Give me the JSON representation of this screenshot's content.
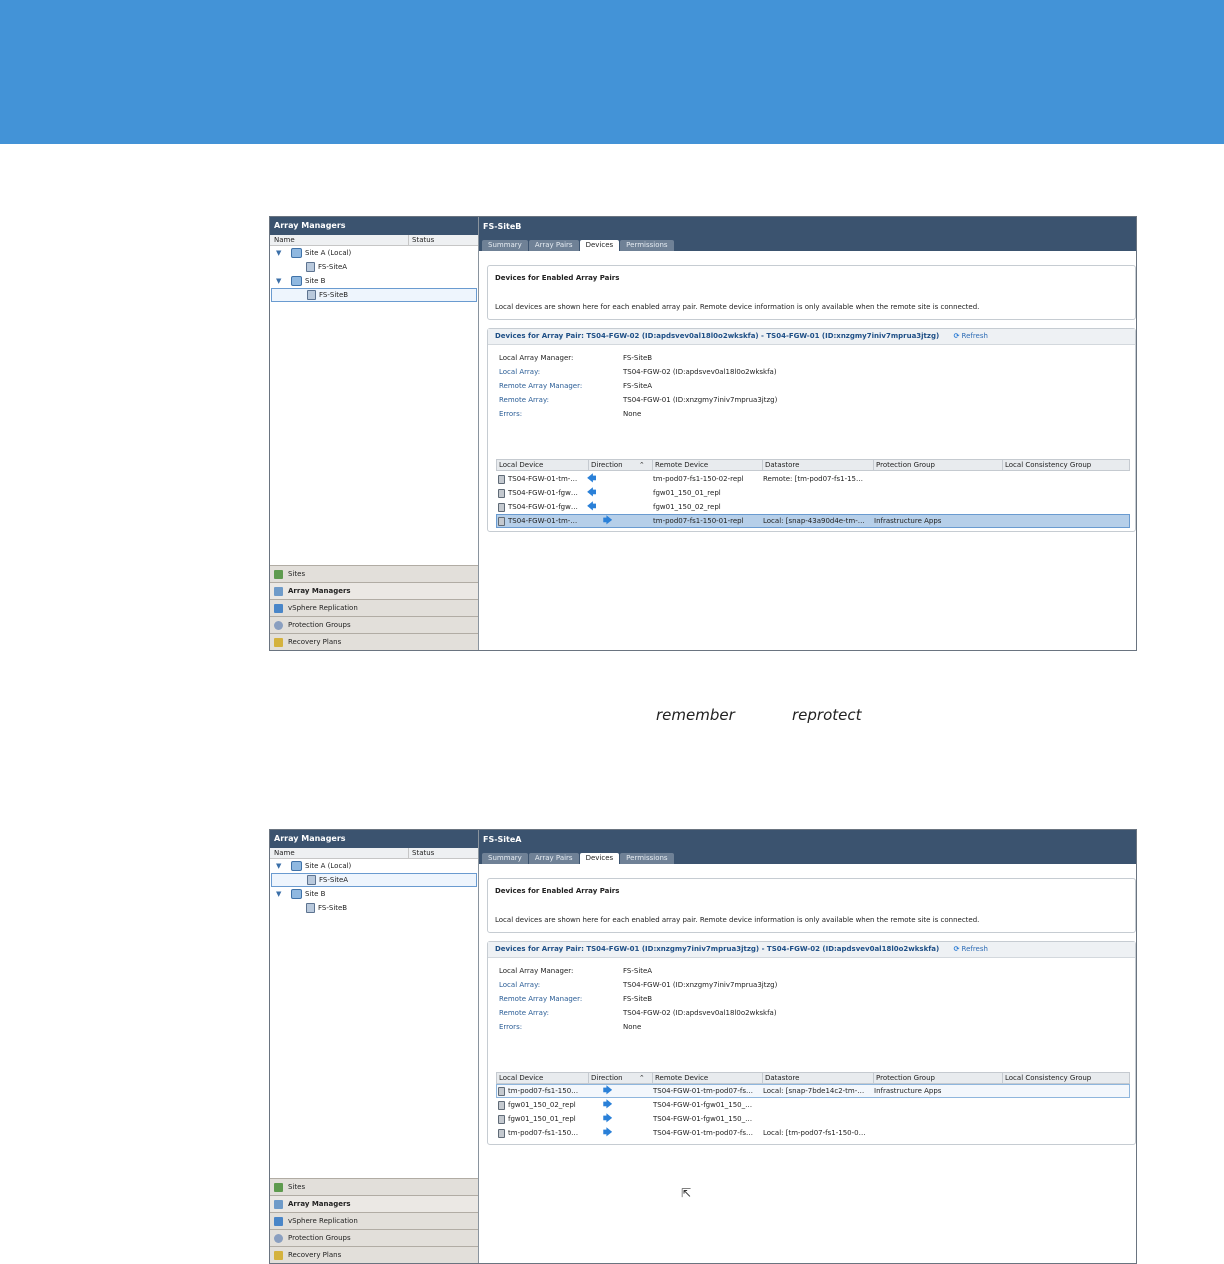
{
  "caption": {
    "word1": "remember",
    "word2": "reprotect"
  },
  "screens": [
    {
      "left": {
        "title": "Array Managers",
        "cols": [
          "Name",
          "Status"
        ],
        "tree": [
          {
            "label": "Site A (Local)",
            "child": "FS-SiteA"
          },
          {
            "label": "Site B",
            "child": "FS-SiteB"
          }
        ],
        "nav": [
          "Sites",
          "Array Managers",
          "vSphere Replication",
          "Protection Groups",
          "Recovery Plans"
        ]
      },
      "title": "FS-SiteB",
      "tabs": [
        "Summary",
        "Array Pairs",
        "Devices",
        "Permissions"
      ],
      "enabled": {
        "heading": "Devices for Enabled Array Pairs",
        "text": "Local devices are shown here for each enabled array pair. Remote device information is only available when the remote site is connected."
      },
      "pair": {
        "title": "Devices for Array Pair: TS04-FGW-02 (ID:apdsvev0al18l0o2wkskfa) - TS04-FGW-01 (ID:xnzgmy7iniv7mprua3jtzg)",
        "refresh": "Refresh",
        "fields": [
          {
            "k": "Local Array Manager:",
            "v": "FS-SiteB"
          },
          {
            "k": "Local Array:",
            "v": "TS04-FGW-02 (ID:apdsvev0al18l0o2wkskfa)"
          },
          {
            "k": "Remote Array Manager:",
            "v": "FS-SiteA"
          },
          {
            "k": "Remote Array:",
            "v": "TS04-FGW-01 (ID:xnzgmy7iniv7mprua3jtzg)"
          },
          {
            "k": "Errors:",
            "v": "None"
          }
        ],
        "columns": [
          "Local Device",
          "Direction",
          "Remote Device",
          "Datastore",
          "Protection Group",
          "Local Consistency Group"
        ],
        "rows": [
          {
            "local": "TS04-FGW-01-tm-…",
            "dir": "left",
            "remote": "tm-pod07-fs1-150-02-repl",
            "datastore": "Remote: [tm-pod07-fs1-15…",
            "group": "",
            "cgroup": ""
          },
          {
            "local": "TS04-FGW-01-fgw…",
            "dir": "left",
            "remote": "fgw01_150_01_repl",
            "datastore": "",
            "group": "",
            "cgroup": ""
          },
          {
            "local": "TS04-FGW-01-fgw…",
            "dir": "left",
            "remote": "fgw01_150_02_repl",
            "datastore": "",
            "group": "",
            "cgroup": ""
          },
          {
            "local": "TS04-FGW-01-tm-…",
            "dir": "right",
            "remote": "tm-pod07-fs1-150-01-repl",
            "datastore": "Local: [snap-43a90d4e-tm-…",
            "group": "Infrastructure Apps",
            "cgroup": ""
          }
        ]
      }
    },
    {
      "left": {
        "title": "Array Managers",
        "cols": [
          "Name",
          "Status"
        ],
        "tree": [
          {
            "label": "Site A (Local)",
            "child": "FS-SiteA"
          },
          {
            "label": "Site B",
            "child": "FS-SiteB"
          }
        ],
        "nav": [
          "Sites",
          "Array Managers",
          "vSphere Replication",
          "Protection Groups",
          "Recovery Plans"
        ]
      },
      "title": "FS-SiteA",
      "tabs": [
        "Summary",
        "Array Pairs",
        "Devices",
        "Permissions"
      ],
      "enabled": {
        "heading": "Devices for Enabled Array Pairs",
        "text": "Local devices are shown here for each enabled array pair. Remote device information is only available when the remote site is connected."
      },
      "pair": {
        "title": "Devices for Array Pair: TS04-FGW-01 (ID:xnzgmy7iniv7mprua3jtzg) - TS04-FGW-02 (ID:apdsvev0al18l0o2wkskfa)",
        "refresh": "Refresh",
        "fields": [
          {
            "k": "Local Array Manager:",
            "v": "FS-SiteA"
          },
          {
            "k": "Local Array:",
            "v": "TS04-FGW-01 (ID:xnzgmy7iniv7mprua3jtzg)"
          },
          {
            "k": "Remote Array Manager:",
            "v": "FS-SiteB"
          },
          {
            "k": "Remote Array:",
            "v": "TS04-FGW-02 (ID:apdsvev0al18l0o2wkskfa)"
          },
          {
            "k": "Errors:",
            "v": "None"
          }
        ],
        "columns": [
          "Local Device",
          "Direction",
          "Remote Device",
          "Datastore",
          "Protection Group",
          "Local Consistency Group"
        ],
        "rows": [
          {
            "local": "tm-pod07-fs1-150…",
            "dir": "right",
            "remote": "TS04-FGW-01-tm-pod07-fs…",
            "datastore": "Local: [snap-7bde14c2-tm-…",
            "group": "Infrastructure Apps",
            "cgroup": ""
          },
          {
            "local": "fgw01_150_02_repl",
            "dir": "right",
            "remote": "TS04-FGW-01-fgw01_150_…",
            "datastore": "",
            "group": "",
            "cgroup": ""
          },
          {
            "local": "fgw01_150_01_repl",
            "dir": "right",
            "remote": "TS04-FGW-01-fgw01_150_…",
            "datastore": "",
            "group": "",
            "cgroup": ""
          },
          {
            "local": "tm-pod07-fs1-150…",
            "dir": "right",
            "remote": "TS04-FGW-01-tm-pod07-fs…",
            "datastore": "Local: [tm-pod07-fs1-150-0…",
            "group": "",
            "cgroup": ""
          }
        ]
      }
    }
  ]
}
